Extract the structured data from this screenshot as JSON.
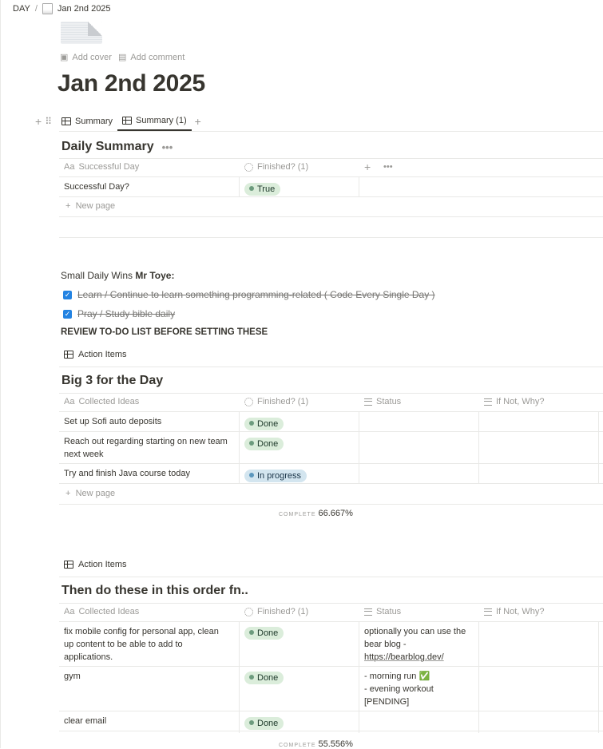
{
  "breadcrumb": {
    "root": "DAY",
    "separator": "/",
    "page": "Jan 2nd 2025"
  },
  "meta": {
    "add_cover": "Add cover",
    "add_comment": "Add comment"
  },
  "title": "Jan 2nd 2025",
  "view_tabs": [
    {
      "label": "Summary"
    },
    {
      "label": "Summary (1)"
    }
  ],
  "daily_summary": {
    "title": "Daily Summary",
    "columns": [
      "Successful Day",
      "Finished? (1)"
    ],
    "rows": [
      {
        "name": "Successful Day?",
        "finished": "True"
      }
    ],
    "new_page": "New page"
  },
  "wins": {
    "heading_prefix": "Small Daily Wins ",
    "heading_bold": "Mr Toye:",
    "items": [
      "Learn / Continue to learn something programming-related ( Code Every Single Day )",
      "Pray / Study bible daily"
    ],
    "review_note": "REVIEW TO-DO LIST BEFORE SETTING THESE"
  },
  "big3": {
    "view_label": "Action Items",
    "title": "Big 3 for the Day",
    "columns": [
      "Collected Ideas",
      "Finished? (1)",
      "Status",
      "If Not, Why?"
    ],
    "rows": [
      {
        "idea_line1": "Set up Sofi auto deposits",
        "idea_line2": "",
        "finished": "Done",
        "finished_color": "green"
      },
      {
        "idea_line1": "Reach out regarding starting on new team",
        "idea_line2": "next week",
        "finished": "Done",
        "finished_color": "green"
      },
      {
        "idea_line1": "Try and finish Java course today",
        "idea_line2": "",
        "finished": "In progress",
        "finished_color": "blue"
      }
    ],
    "new_page": "New page",
    "complete_label": "COMPLETE",
    "complete_value": "66.667%"
  },
  "ordered": {
    "view_label": "Action Items",
    "title": "Then do these in this order fn..",
    "columns": [
      "Collected Ideas",
      "Finished? (1)",
      "Status",
      "If Not, Why?"
    ],
    "rows": [
      {
        "idea": [
          "fix mobile config for personal app, clean",
          "up content to be able to add to",
          "applications."
        ],
        "finished": "Done",
        "status": [
          "optionally you can use the",
          "bear blog -"
        ],
        "status_link": "https://bearblog.dev/"
      },
      {
        "idea": [
          "gym"
        ],
        "finished": "Done",
        "status": [
          "- morning run ✅",
          "- evening workout",
          "[PENDING]"
        ]
      },
      {
        "idea": [
          "clear email"
        ],
        "finished": "Done",
        "status": []
      }
    ],
    "complete_label": "COMPLETE",
    "complete_value": "55.556%"
  },
  "colors": {
    "done_tag": "#dbeddb",
    "progress_tag": "#d3e5ef",
    "checkbox": "#2383e2"
  }
}
